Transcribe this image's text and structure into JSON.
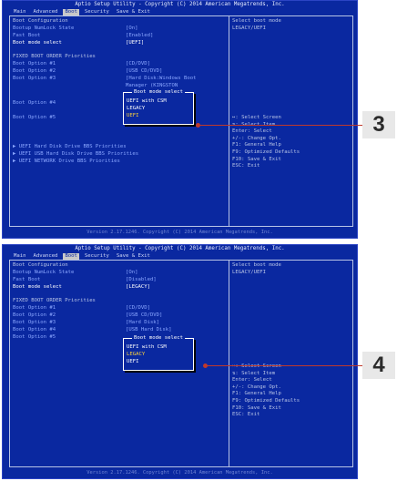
{
  "title": "Aptio Setup Utility - Copyright (C) 2014 American Megatrends, Inc.",
  "tabs": [
    "Main",
    "Advanced",
    "Boot",
    "Security",
    "Save & Exit"
  ],
  "footer": "Version 2.17.1246. Copyright (C) 2014 American Megatrends, Inc.",
  "help_text": "Select boot mode\nLEGACY/UEFI",
  "keys_text": "↔: Select Screen\n⇅: Select Item\nEnter: Select\n+/-: Change Opt.\nF1: General Help\nF9: Optimized Defaults\nF10: Save & Exit\nESC: Exit",
  "popup_title": "Boot mode select",
  "popup_options": [
    "UEFI with CSM",
    "LEGACY",
    "UEFI"
  ],
  "screen1": {
    "boot_config": "Boot Configuration",
    "numlock_label": "Bootup NumLock State",
    "numlock_value": "[On]",
    "fastboot_label": "Fast Boot",
    "fastboot_value": "[Enabled]",
    "bootmode_label": "Boot mode select",
    "bootmode_value": "[UEFI]",
    "fixed_order": "FIXED BOOT ORDER Priorities",
    "opt1_label": "Boot Option #1",
    "opt1_value": "[CD/DVD]",
    "opt2_label": "Boot Option #2",
    "opt2_value": "[USB CD/DVD]",
    "opt3_label": "Boot Option #3",
    "opt3_value": "[Hard Disk:Windows Boot",
    "opt3_value2": "Manager (KINGSTON",
    "opt4_label": "Boot Option #4",
    "opt5_label": "Boot Option #5",
    "uefi_hdd": "▶ UEFI Hard Disk Drive BBS Priorities",
    "uefi_usb": "▶ UEFI USB Hard Disk Drive BBS Priorities",
    "uefi_net": "▶ UEFI NETWORK Drive BBS Priorities",
    "selected_index": 2,
    "badge": "3"
  },
  "screen2": {
    "boot_config": "Boot Configuration",
    "numlock_label": "Bootup NumLock State",
    "numlock_value": "[On]",
    "fastboot_label": "Fast Boot",
    "fastboot_value": "[Disabled]",
    "bootmode_label": "Boot mode select",
    "bootmode_value": "[LEGACY]",
    "fixed_order": "FIXED BOOT ORDER Priorities",
    "opt1_label": "Boot Option #1",
    "opt1_value": "[CD/DVD]",
    "opt2_label": "Boot Option #2",
    "opt2_value": "[USB CD/DVD]",
    "opt3_label": "Boot Option #3",
    "opt3_value": "[Hard Disk]",
    "opt4_label": "Boot Option #4",
    "opt4_value": "[USB Hard Disk]",
    "opt5_label": "Boot Option #5",
    "selected_index": 1,
    "badge": "4"
  },
  "colors": {
    "bios_blue": "#0a28a0",
    "highlight": "#ffd23a",
    "callout": "#c0392b",
    "tab_active": "#c8c8c8"
  }
}
